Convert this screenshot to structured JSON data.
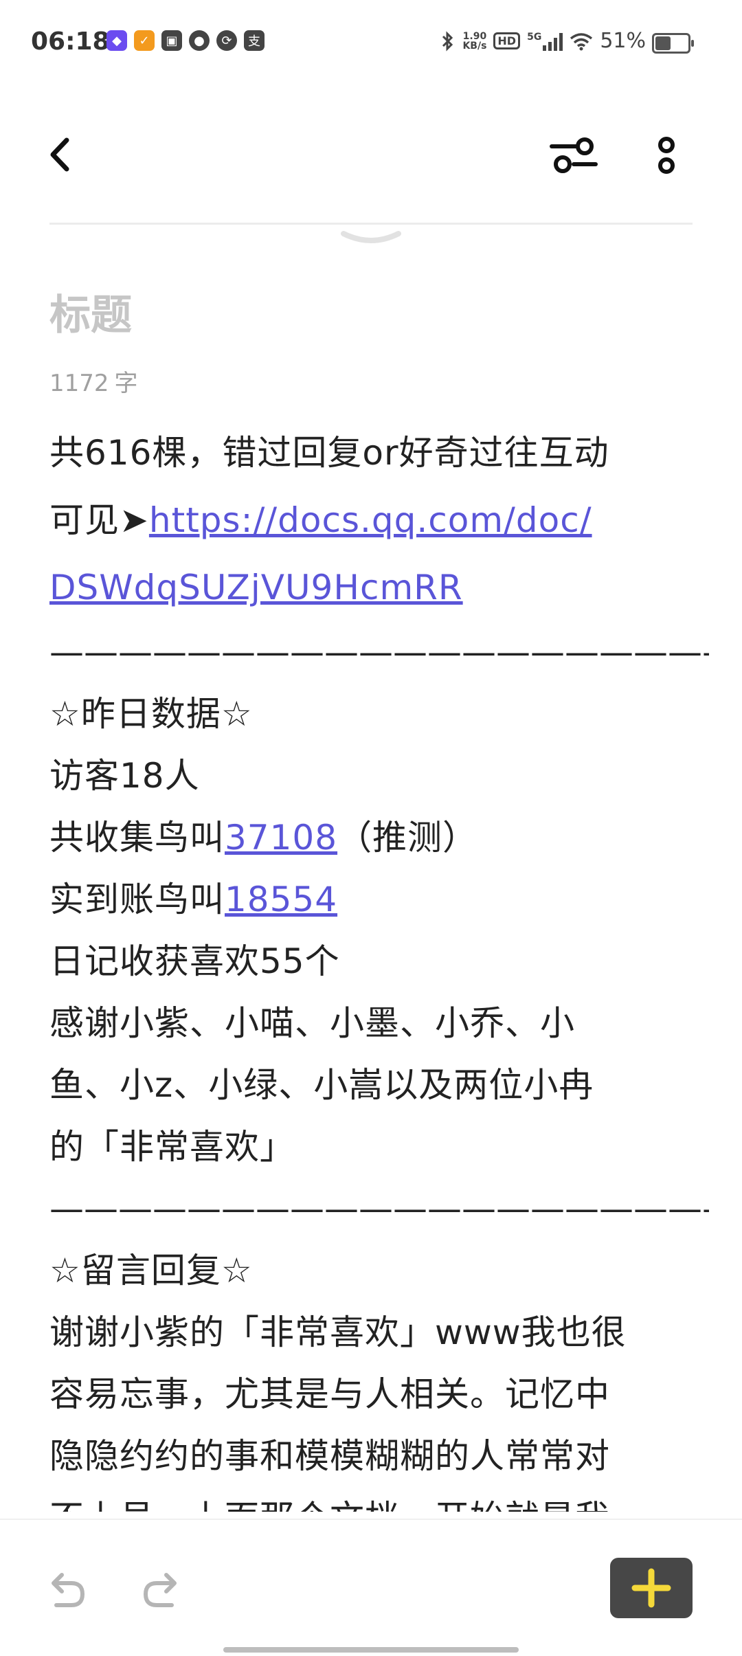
{
  "status_bar": {
    "time": "06:18",
    "net_speed_value": "1.90",
    "net_speed_unit": "KB/s",
    "hd_label": "HD",
    "network_type": "5G",
    "battery": "51%",
    "notification_icons": [
      "app-purple-icon",
      "app-orange-icon",
      "message-icon",
      "weibo-icon",
      "sync-icon",
      "alipay-icon"
    ]
  },
  "toolbar": {
    "icons": [
      "back-arrow-icon",
      "filter-toggle-icon",
      "more-vertical-icon"
    ]
  },
  "editor": {
    "title_placeholder": "标题",
    "word_count": "1172",
    "word_count_unit": "字",
    "link_color": "#5a55d8",
    "intro": {
      "line1": "共616棵，错过回复or好奇过往互动",
      "line2_prefix": "可见➤",
      "link_part1": "https://docs.qq.com/doc/",
      "link_part2": "DSWdqSUZjVU9HcmRR"
    },
    "divider1": "————————————————————————",
    "section1": {
      "heading": "☆昨日数据☆",
      "visitors": "访客18人",
      "collected_prefix": "共收集鸟叫",
      "collected_value": "37108",
      "collected_suffix": "（推测）",
      "received_prefix": "实到账鸟叫",
      "received_value": "18554",
      "likes": "日记收获喜欢55个",
      "thanks_line1": "感谢小紫、小喵、小墨、小乔、小",
      "thanks_line2": "鱼、小z、小绿、小嵩以及两位小冉",
      "thanks_line3": "的「非常喜欢」"
    },
    "divider2": "————————————————————————",
    "section2": {
      "heading": "☆留言回复☆",
      "line1": "谢谢小紫的「非常喜欢」www我也很",
      "line2": "容易忘事，尤其是与人相关。记忆中",
      "line3": "隐隐约约的事和模模糊糊的人常常对",
      "line4": "不上号。上面那个文档一开始就是我"
    }
  },
  "bottom_bar": {
    "icons": [
      "undo-icon",
      "redo-icon",
      "plus-icon"
    ],
    "add_button_color": "#474747",
    "plus_color": "#f5d93a"
  }
}
